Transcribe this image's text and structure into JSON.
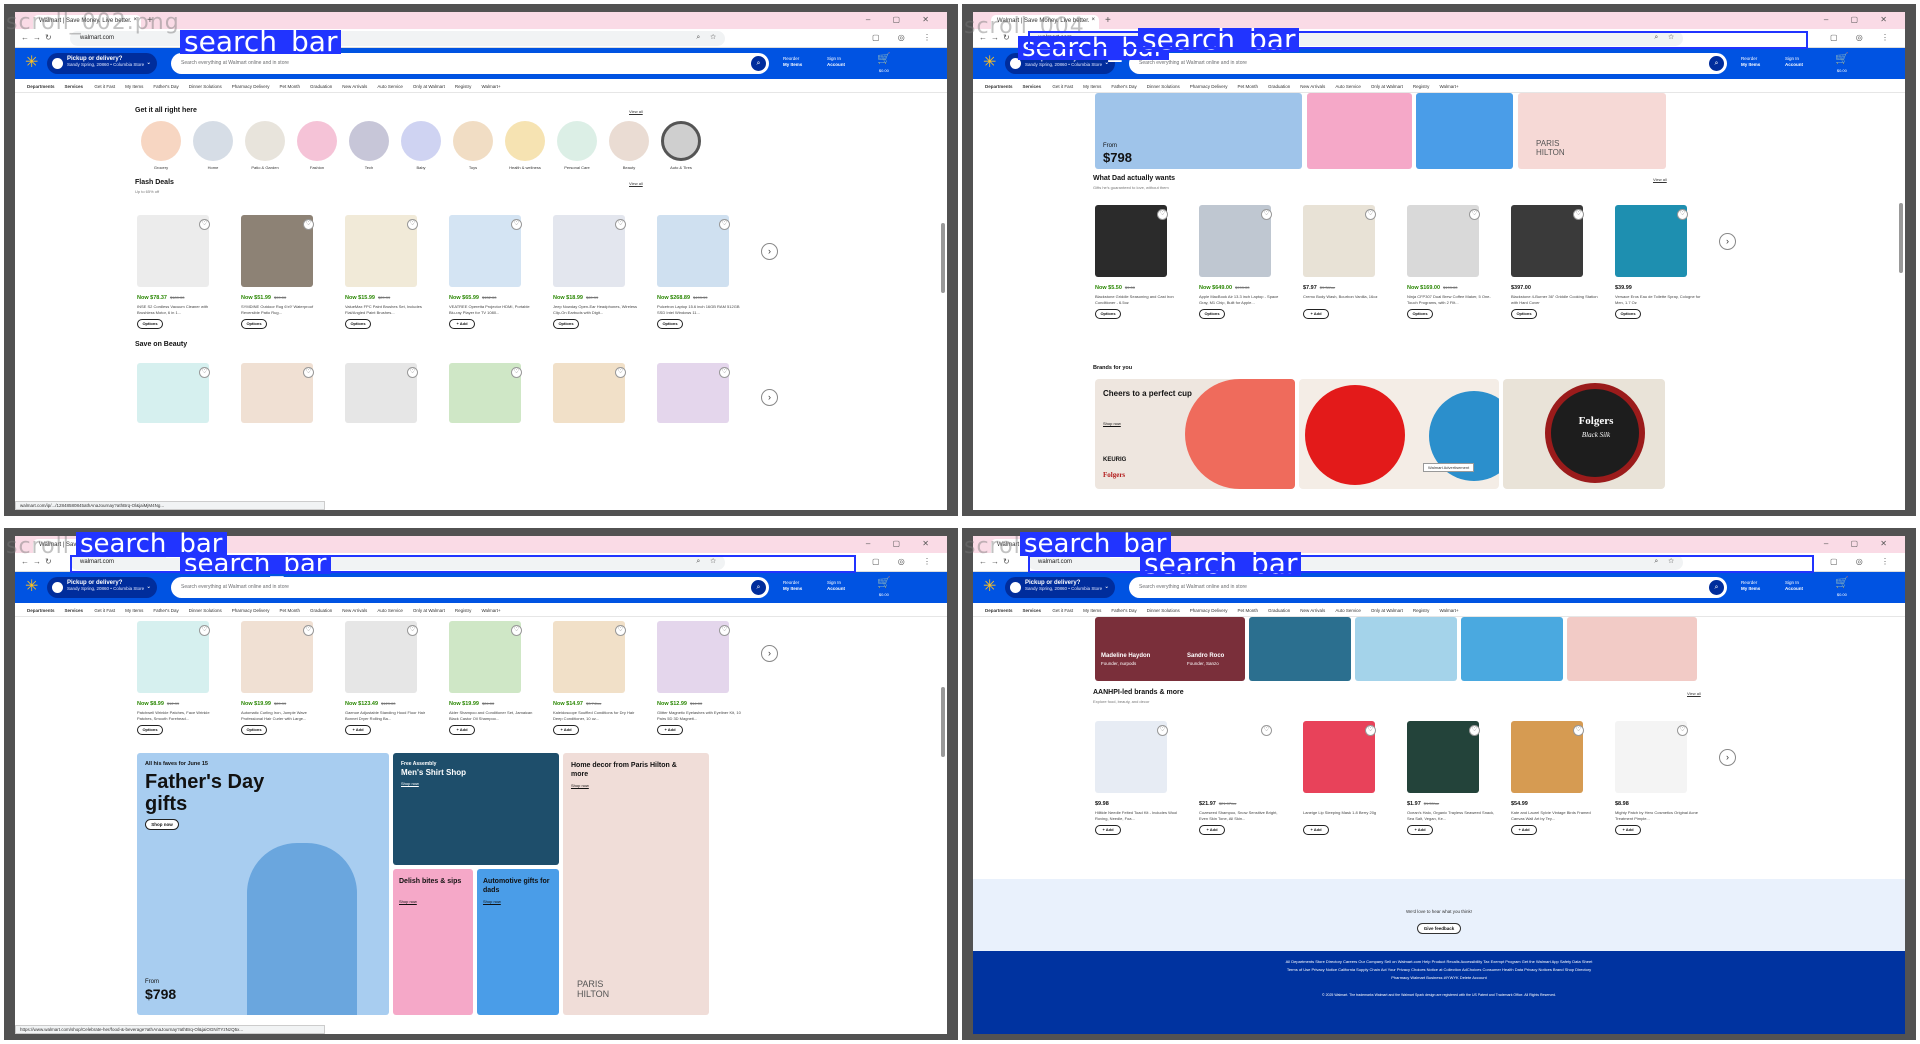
{
  "annotation_label": "search_bar",
  "browser": {
    "tab_title": "Walmart | Save Money. Live better.",
    "url": "walmart.com",
    "window_controls": "– ▢ ✕"
  },
  "walmart": {
    "pickup_title": "Pickup or delivery?",
    "pickup_sub": "Sandy Spring, 20860 • Columbia Store",
    "search_placeholder": "Search everything at Walmart online and in store",
    "reorder_top": "Reorder",
    "reorder_bottom": "My Items",
    "signin_top": "Sign In",
    "signin_bottom": "Account",
    "cart_amount": "$0.00",
    "nav_departments": "Departments",
    "nav_services": "Services",
    "nav_links": [
      "Get it Fast",
      "My Items",
      "Father's Day",
      "Dinner Solutions",
      "Pharmacy Delivery",
      "Pet Month",
      "Graduation",
      "New Arrivals",
      "Auto Service",
      "Only at Walmart",
      "Registry",
      "Walmart+"
    ]
  },
  "panel_a": {
    "get_it_title": "Get it all right here",
    "view_all": "View all",
    "categories": [
      "Grocery",
      "Home",
      "Patio & Garden",
      "Fashion",
      "Tech",
      "Baby",
      "Toys",
      "Health & wellness",
      "Personal Care",
      "Beauty",
      "Auto & Tires"
    ],
    "flash_title": "Flash Deals",
    "flash_sub": "Up to 65% off",
    "flash_products": [
      {
        "price": "Now $78.37",
        "was": "$189.00",
        "name": "INSE S2 Cordless Vacuum Cleaner with Brushless Motor, 6 in 1...",
        "btn": "Options"
      },
      {
        "price": "Now $51.99",
        "was": "$99.00",
        "name": "SYMDINE Outdoor Rug 6'x9' Waterproof Reversible Patio Rug...",
        "btn": "Options"
      },
      {
        "price": "Now $15.99",
        "was": "$29.99",
        "name": "ValueMax FPC Paint Brushes Set, Includes Flat/Angled Paint Brushes...",
        "btn": "Options"
      },
      {
        "price": "Now $65.99",
        "was": "$132.00",
        "name": "VEATREE Operetta Projector HDMI, Portable Blu-ray Player for TV 1080...",
        "btn": "+ Add"
      },
      {
        "price": "Now $18.99",
        "was": "$69.99",
        "name": "Jeep Nowday Open-Ear Headphones, Wireless Clip-On Earbuds with Digit...",
        "btn": "Options"
      },
      {
        "price": "Now $268.89",
        "was": "$499.99",
        "name": "Pulcetron Laptop 15.6 inch 16GB RAM 512GB SSD Intel Windows 11...",
        "btn": "Options"
      }
    ],
    "beauty_title": "Save on Beauty",
    "status_url": "walmart.com/ip/.../12848580845athAnaJournay?athBrq-Ol&jaiMjM4Ng..."
  },
  "panel_b": {
    "from_label": "From",
    "from_price": "$798",
    "dad_title": "What Dad actually wants",
    "dad_sub": "Gifts he's guaranteed to love, without them",
    "view_all": "View all",
    "dad_products": [
      {
        "price": "Now $5.50",
        "was": "$9.00",
        "name": "Blackstone Griddle Seasoning and Cast Iron Conditioner - 6.5oz",
        "btn": "Options",
        "green": true
      },
      {
        "price": "Now $649.00",
        "was": "$999.00",
        "name": "Apple MacBook Air 13.3 inch Laptop - Space Gray, M1 Chip, Built for Apple...",
        "btn": "Options",
        "green": true
      },
      {
        "price": "$7.97",
        "was": "$9.34/oz",
        "name": "Cremo Body Wash, Bourbon Vanilla, 16oz",
        "btn": "+ Add",
        "green": false
      },
      {
        "price": "Now $169.00",
        "was": "$199.00",
        "name": "Ninja CFP307 Dual Brew Coffee Maker, 5 One-Touch Programs, with 2 Filt...",
        "btn": "Options",
        "green": true
      },
      {
        "price": "$397.00",
        "was": "",
        "name": "Blackstone 4-Burner 36\" Griddle Cooking Station with Hard Cover",
        "btn": "Options",
        "green": false
      },
      {
        "price": "$39.99",
        "was": "",
        "name": "Versace Eros Eau de Toilette Spray, Cologne for Men, 1.7 Oz",
        "btn": "Options",
        "green": false
      }
    ],
    "brands_title": "Brands for you",
    "brand_headline": "Cheers to a perfect cup",
    "brand_link": "Shop now",
    "brand_logo": "KEURIG",
    "brand_logo2": "Folgers",
    "brand_can": "Folgers",
    "brand_can_sub": "Black Silk",
    "ad_label": "Walmart Advertisement",
    "paris_label": "PARIS HILTON"
  },
  "panel_c": {
    "beauty_products": [
      {
        "price": "Now $8.99",
        "was": "$12.99",
        "name": "Patchwell Wrinkle Patches, Face Wrinkle Patches, Smooth Forehead...",
        "btn": "Options"
      },
      {
        "price": "Now $19.99",
        "was": "$29.99",
        "name": "Automatic Curling Iron, Jumple Wave Professional Hair Curler with Large...",
        "btn": "Options"
      },
      {
        "price": "Now $123.49",
        "was": "$129.00",
        "name": "Gaenoe Adjustable Standing Hood Floor Hair Bonnet Dryer Rolling Ba...",
        "btn": "+ Add"
      },
      {
        "price": "Now $19.99",
        "was": "$24.00",
        "name": "Alder Shampoo and Conditioner Set, Jamaican Black Castor Oil Shampoo...",
        "btn": "+ Add"
      },
      {
        "price": "Now $14.97",
        "was": "$3.74/oz",
        "name": "Kaleidoscope Souffled Conditions for Dry Hair Deep Conditioner, 10 oz...",
        "btn": "+ Add"
      },
      {
        "price": "Now $12.99",
        "was": "$14.00",
        "name": "Glitter Magnetic Eyelashes with Eyeliner Kit, 10 Pairs 5D 3D Magneti...",
        "btn": "+ Add"
      }
    ],
    "hero_kicker": "All his faves for June 15",
    "hero_title": "Father's Day gifts",
    "hero_btn": "Shop now",
    "hero_from": "From",
    "hero_price": "$798",
    "shirt_kicker": "Free Assembly",
    "shirt_title": "Men's Shirt Shop",
    "shirt_link": "Shop now",
    "bites_title": "Delish bites & sips",
    "bites_link": "Shop now",
    "auto_title": "Automotive gifts for dads",
    "auto_link": "Shop now",
    "paris_title": "Home decor from Paris Hilton & more",
    "paris_link": "Shop now",
    "paris_label": "PARIS HILTON",
    "status_url": "https://www.walmart.com/shop/Celebrate-her/food-&-beverage?athAnaJournay?athBrq-Ol&jaiOGNiTYzNzQ5x..."
  },
  "panel_d": {
    "madeline": "Madeline Haydon",
    "madeline_sub": "Founder, nurpods",
    "sandro": "Sandro Roco",
    "sandro_sub": "Founder, Sanzo",
    "aanhpi_title": "AANHPI-led brands & more",
    "aanhpi_sub": "Explore food, beauty, and decor",
    "view_all": "View all",
    "aanhpi_products": [
      {
        "price": "$9.98",
        "name": "Hilltide Needle Felted Toad Kit - Includes Wool Roving, Needle, Foa...",
        "btn": "+ Add"
      },
      {
        "price": "$21.97",
        "was": "$21.97/oz",
        "name": "Cozeseed Shampoo, Snow Sensitive Bright, Even Skin Tone, All Skin...",
        "btn": "+ Add"
      },
      {
        "price": "",
        "name": "Laneige Lip Sleeping Mask 1.8 Berry 20g",
        "btn": "+ Add"
      },
      {
        "price": "$1.97",
        "was": "$1.59/oz",
        "name": "Ocean's Halo, Organic Trayless Seaweed Snack, Sea Salt, Vegan, Ke...",
        "btn": "+ Add"
      },
      {
        "price": "$54.99",
        "name": "Kate and Laurel Sylvie Vintage Birds Framed Canvas Wall Art by Tey...",
        "btn": "+ Add"
      },
      {
        "price": "$8.98",
        "name": "Mighty Patch by Hero Cosmetics Original Acne Treatment Pimple...",
        "btn": "+ Add"
      }
    ],
    "feedback_text": "We'd love to hear what you think!",
    "feedback_btn": "Give feedback",
    "footer_row1": "All Departments   Store Directory   Careers   Our Company   Sell on Walmart.com   Help   Product Recalls   Accessibility   Tax Exempt Program   Get the Walmart App   Safety Data Sheet",
    "footer_row2": "Terms of Use   Privacy Notice   California Supply Chain Act   Your Privacy Choices   Notice at Collection   AdChoices   Consumer Health Data Privacy Notices   Brand Shop Directory",
    "footer_row3": "Pharmacy   Walmart Business   #IYWYK   Delete Account",
    "footer_copy": "© 2025 Walmart. The trademarks Walmart and the Walmart Spark design are registered with the US Patent and Trademark Office. All Rights Reserved."
  },
  "ghost_labels": {
    "a": "scroll_002.png",
    "b": "scroll_004",
    "c": "scroll",
    "d": "scroll"
  }
}
